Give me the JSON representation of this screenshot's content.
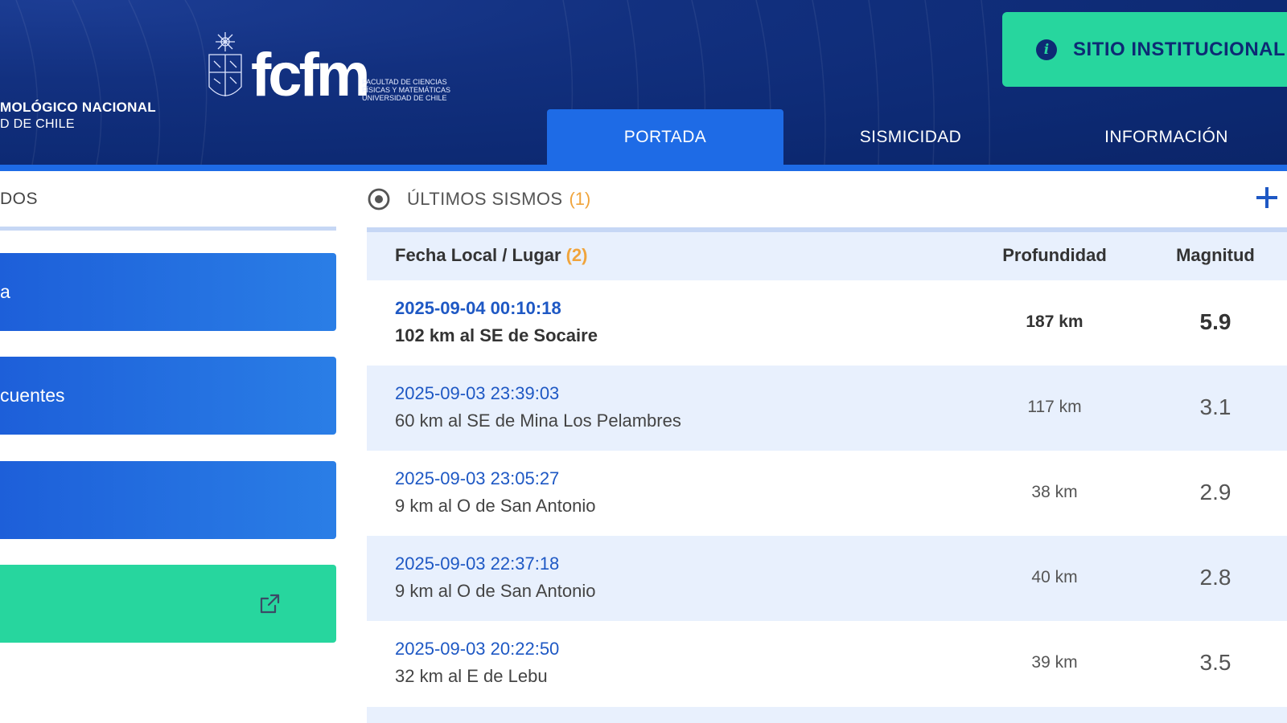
{
  "header": {
    "brand_line1": "MOLÓGICO NACIONAL",
    "brand_line2": "D DE CHILE",
    "fcfm_logo": "fcfm",
    "fcfm_sub": [
      "FACULTAD DE CIENCIAS",
      "FÍSICAS Y MATEMÁTICAS",
      "UNIVERSIDAD DE CHILE"
    ],
    "sitio_label": "SITIO INSTITUCIONAL",
    "nav": [
      {
        "label": "PORTADA",
        "active": true
      },
      {
        "label": "SISMICIDAD",
        "active": false
      },
      {
        "label": "INFORMACIÓN",
        "active": false
      }
    ]
  },
  "left": {
    "title": "DOS",
    "cards": [
      {
        "label": "a",
        "color": "#1e6be6"
      },
      {
        "label": "cuentes",
        "color": "#1e6be6"
      },
      {
        "label": "",
        "color": "#1e6be6"
      },
      {
        "label": "",
        "color": "#27d69e",
        "icon": "external-link-icon"
      }
    ]
  },
  "panel": {
    "title": "ÚLTIMOS SISMOS",
    "count": "(1)",
    "icon": "target-icon",
    "add_icon": "plus-icon",
    "columns": {
      "place": "Fecha Local / Lugar",
      "place_count": "(2)",
      "depth": "Profundidad",
      "magnitude": "Magnitud"
    },
    "rows": [
      {
        "date": "2025-09-04 00:10:18",
        "place": "102 km al SE de Socaire",
        "depth": "187 km",
        "magnitude": "5.9",
        "highlight": true
      },
      {
        "date": "2025-09-03 23:39:03",
        "place": "60 km al SE de Mina Los Pelambres",
        "depth": "117 km",
        "magnitude": "3.1",
        "highlight": false
      },
      {
        "date": "2025-09-03 23:05:27",
        "place": "9 km al O de San Antonio",
        "depth": "38 km",
        "magnitude": "2.9",
        "highlight": false
      },
      {
        "date": "2025-09-03 22:37:18",
        "place": "9 km al O de San Antonio",
        "depth": "40 km",
        "magnitude": "2.8",
        "highlight": false
      },
      {
        "date": "2025-09-03 20:22:50",
        "place": "32 km al E de Lebu",
        "depth": "39 km",
        "magnitude": "3.5",
        "highlight": false
      }
    ]
  },
  "colors": {
    "header_bg": "#0d2a74",
    "accent_blue": "#1e6be6",
    "accent_green": "#27d69e",
    "count_orange": "#f0a43c",
    "link_blue": "#1e58c4",
    "row_alt": "#e8f0fd"
  }
}
